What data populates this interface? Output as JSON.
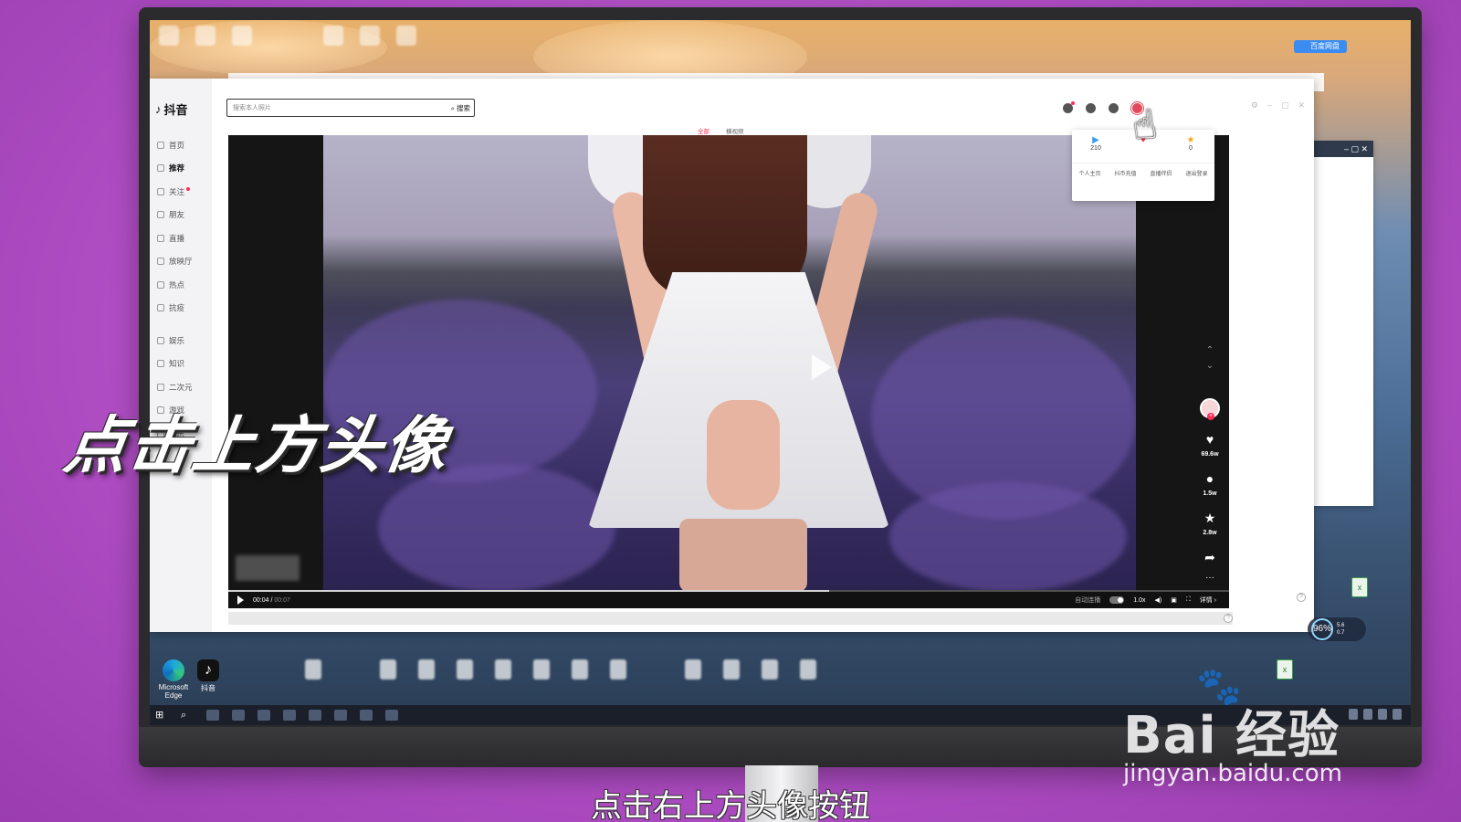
{
  "overlay": {
    "caption": "点击上方头像",
    "subtitle": "点击右上方头像按钮",
    "watermark_brand": "Bai 经验",
    "watermark_url": "jingyan.baidu.com"
  },
  "app": {
    "brand": "抖音",
    "search_placeholder": "搜索本人照片",
    "search_button": "搜索",
    "tabs": [
      {
        "label": "全部",
        "active": true
      },
      {
        "label": "横视频",
        "active": false
      }
    ],
    "sidebar": [
      {
        "label": "首页",
        "active": false,
        "dot": false,
        "icon": "home-icon"
      },
      {
        "label": "推荐",
        "active": true,
        "dot": false,
        "icon": "thumbs-up-icon"
      },
      {
        "label": "关注",
        "active": false,
        "dot": true,
        "icon": "follow-icon"
      },
      {
        "label": "朋友",
        "active": false,
        "dot": false,
        "icon": "friends-icon"
      },
      {
        "label": "直播",
        "active": false,
        "dot": false,
        "icon": "live-icon"
      },
      {
        "label": "放映厅",
        "active": false,
        "dot": false,
        "icon": "cinema-icon"
      },
      {
        "label": "热点",
        "active": false,
        "dot": false,
        "icon": "hot-icon"
      },
      {
        "label": "抗疫",
        "active": false,
        "dot": false,
        "icon": "shield-icon"
      },
      {
        "label": "娱乐",
        "active": false,
        "dot": false,
        "icon": "entertainment-icon"
      },
      {
        "label": "知识",
        "active": false,
        "dot": false,
        "icon": "knowledge-icon"
      },
      {
        "label": "二次元",
        "active": false,
        "dot": false,
        "icon": "anime-icon"
      },
      {
        "label": "游戏",
        "active": false,
        "dot": false,
        "icon": "game-icon"
      },
      {
        "label": "音乐",
        "active": false,
        "dot": false,
        "icon": "music-icon"
      }
    ],
    "profile_dropdown": {
      "stats": [
        {
          "value": "210",
          "icon": "video-icon"
        },
        {
          "value": "",
          "icon": "like-icon"
        },
        {
          "value": "0",
          "icon": "star-icon"
        }
      ],
      "links": [
        "个人主页",
        "抖币充值",
        "直播伴侣",
        "退出登录"
      ]
    },
    "video": {
      "likes": "69.6w",
      "comments": "1.5w",
      "favorites": "2.8w",
      "time_current": "00:04",
      "time_separator": "/",
      "time_total": "00:07",
      "progress": 0.6,
      "autoplay_label": "自动连播",
      "speed": "1.0x",
      "detail_label": "详情 ›"
    }
  },
  "desktop": {
    "edge_label": "Microsoft Edge",
    "douyin_label": "抖音",
    "speed_percent": "96",
    "speed_unit": "%",
    "rate_up": "5.6",
    "rate_down": "0.7",
    "cloud_badge": "百度网盘"
  },
  "colors": {
    "background": "#b24fc6",
    "douyin_accent": "#fe2c55"
  }
}
